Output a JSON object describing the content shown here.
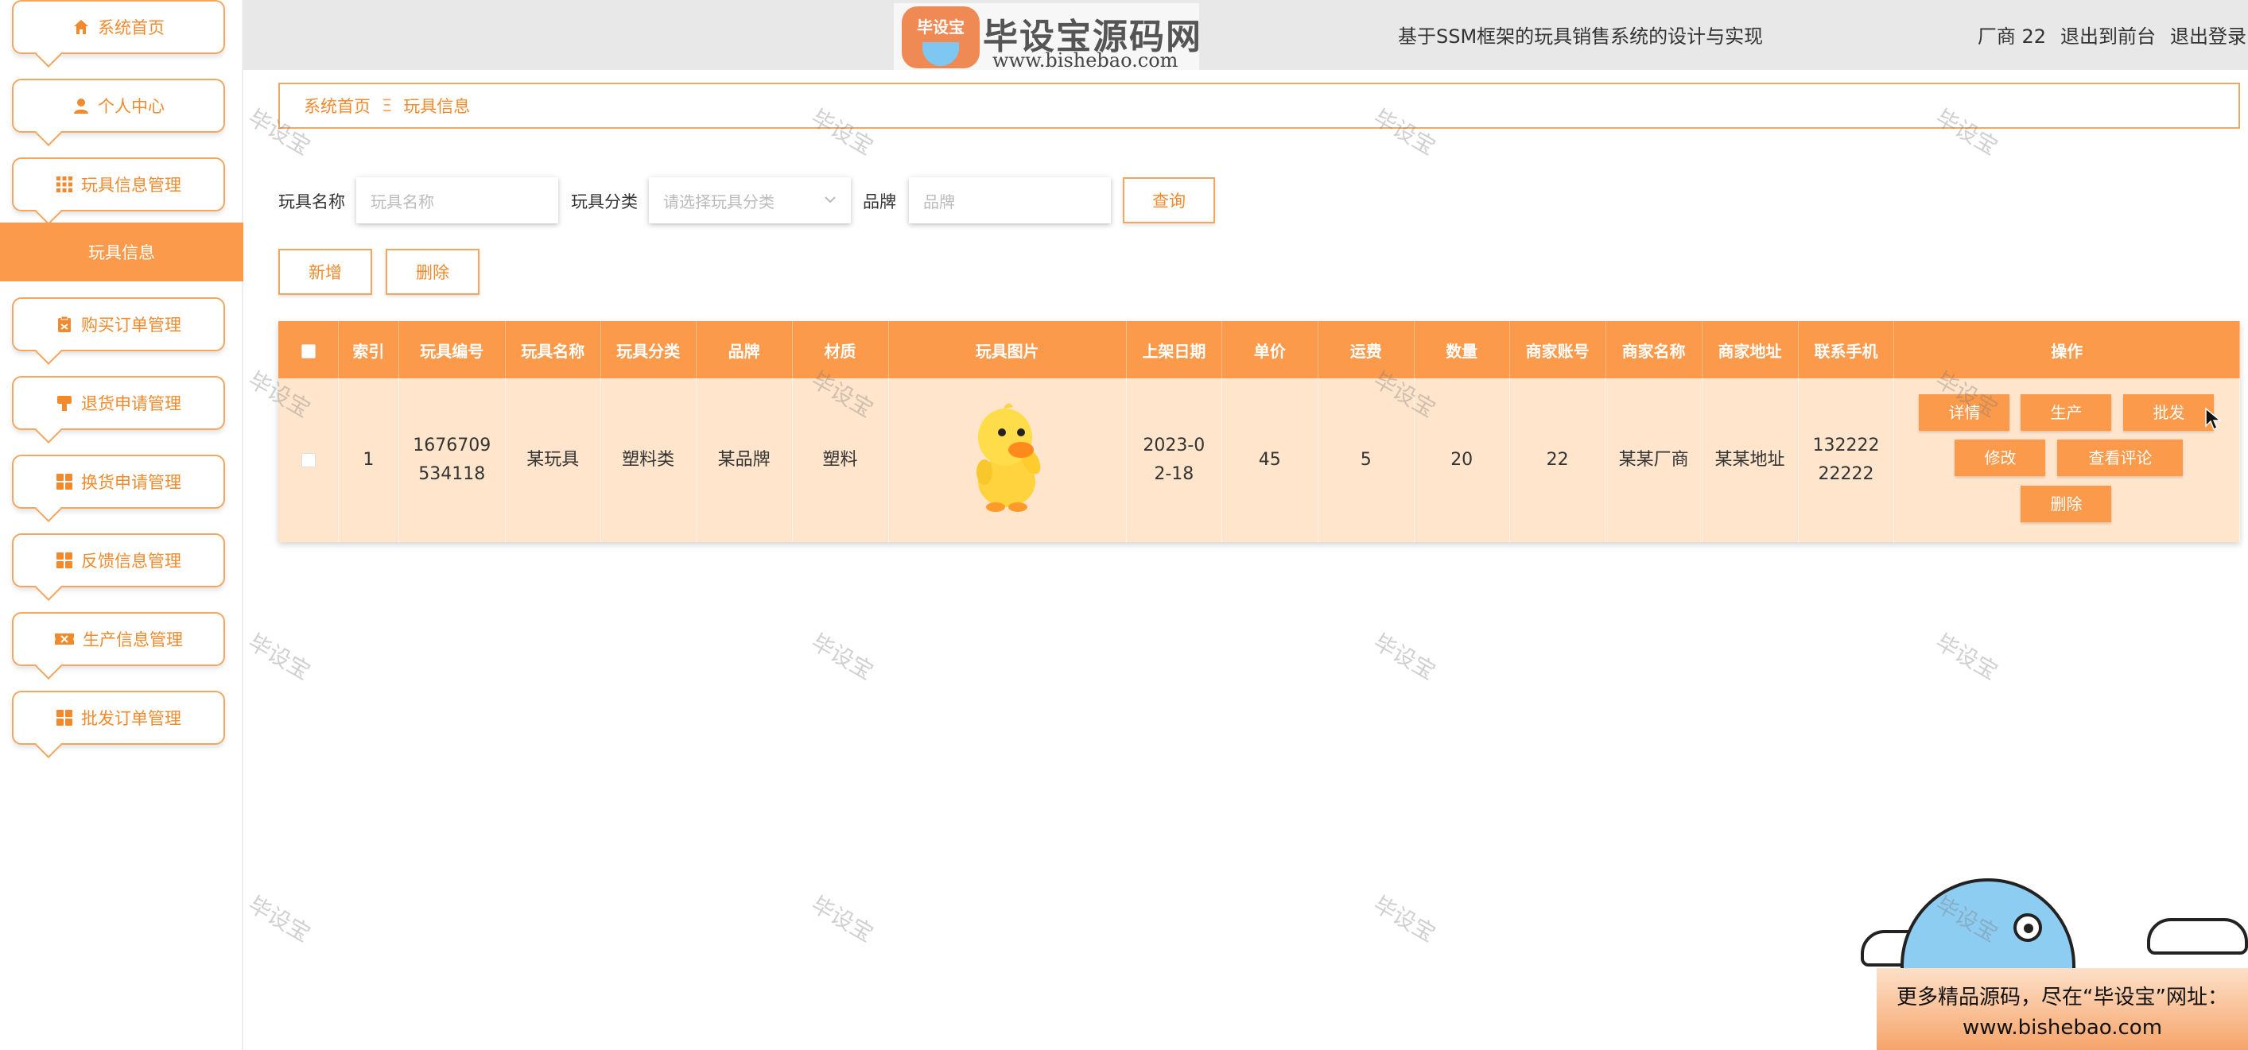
{
  "header": {
    "logo_badge": "毕设宝",
    "logo_text": "毕设宝源码网",
    "logo_url": "www.bishebao.com",
    "site_title": "基于SSM框架的玩具销售系统的设计与实现",
    "user": "厂商 22",
    "to_frontend": "退出到前台",
    "logout": "退出登录"
  },
  "sidebar": {
    "items": [
      {
        "label": "系统首页",
        "icon": "home-icon"
      },
      {
        "label": "个人中心",
        "icon": "user-icon"
      },
      {
        "label": "玩具信息管理",
        "icon": "grid-icon"
      },
      {
        "label": "玩具信息",
        "active": true
      },
      {
        "label": "购买订单管理",
        "icon": "clipboard-icon"
      },
      {
        "label": "退货申请管理",
        "icon": "return-icon"
      },
      {
        "label": "换货申请管理",
        "icon": "apps-icon"
      },
      {
        "label": "反馈信息管理",
        "icon": "apps-icon"
      },
      {
        "label": "生产信息管理",
        "icon": "ticket-icon"
      },
      {
        "label": "批发订单管理",
        "icon": "apps-icon"
      }
    ]
  },
  "breadcrumb": {
    "home": "系统首页",
    "sep": "Ξ",
    "current": "玩具信息"
  },
  "search": {
    "name_label": "玩具名称",
    "name_placeholder": "玩具名称",
    "category_label": "玩具分类",
    "category_placeholder": "请选择玩具分类",
    "brand_label": "品牌",
    "brand_placeholder": "品牌",
    "query_button": "查询"
  },
  "actions": {
    "add": "新增",
    "delete": "删除"
  },
  "table": {
    "columns": [
      "",
      "索引",
      "玩具编号",
      "玩具名称",
      "玩具分类",
      "品牌",
      "材质",
      "玩具图片",
      "上架日期",
      "单价",
      "运费",
      "数量",
      "商家账号",
      "商家名称",
      "商家地址",
      "联系手机",
      "操作"
    ],
    "rows": [
      {
        "index": "1",
        "code": "1676709534118",
        "name": "某玩具",
        "category": "塑料类",
        "brand": "某品牌",
        "material": "塑料",
        "image": "duck-toy-image",
        "date": "2023-02-18",
        "price": "45",
        "shipping": "5",
        "quantity": "20",
        "merchant_account": "22",
        "merchant_name": "某某厂商",
        "merchant_address": "某某地址",
        "phone": "13222222222",
        "ops": {
          "detail": "详情",
          "produce": "生产",
          "wholesale": "批发",
          "edit": "修改",
          "comments": "查看评论",
          "delete": "删除"
        }
      }
    ]
  },
  "watermark": "毕设宝",
  "ad": {
    "line1": "更多精品源码，尽在“毕设宝”网址：",
    "line2": "www.bishebao.com"
  },
  "colors": {
    "accent": "#fb9a4b",
    "border": "#f3a660",
    "text_accent": "#f08a2d",
    "row_bg": "#ffe5cc",
    "topbar_bg": "#e8e8e8"
  }
}
